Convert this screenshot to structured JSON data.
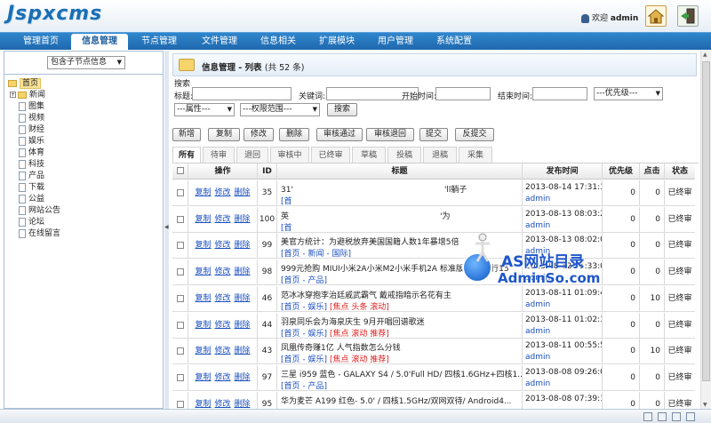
{
  "header": {
    "logo": "Jspxcms",
    "welcome_prefix": "欢迎",
    "username": "admin"
  },
  "nav": {
    "items": [
      "管理首页",
      "信息管理",
      "节点管理",
      "文件管理",
      "信息相关",
      "扩展模块",
      "用户管理",
      "系统配置"
    ],
    "active": "信息管理"
  },
  "sidebar": {
    "scope_select": "包含子节点信息",
    "tree": {
      "root": "首页",
      "children": [
        "新闻",
        "图集",
        "视频",
        "财经",
        "娱乐",
        "体育",
        "科技",
        "产品",
        "下载",
        "公益",
        "网站公告",
        "论坛",
        "在线留言"
      ]
    }
  },
  "page": {
    "title": "信息管理 - 列表",
    "count": "(共 52 条)"
  },
  "search": {
    "heading": "搜索",
    "title_label": "标题:",
    "keyword_label": "关键词:",
    "start_label": "开始时间:",
    "end_label": "结束时间:",
    "priority_select": "---优先级---",
    "attr_select": "---属性---",
    "scope_select": "---权限范围---",
    "search_button": "搜索"
  },
  "toolbar": [
    "新增",
    "复制",
    "修改",
    "删除",
    "审核通过",
    "审核退回",
    "提交",
    "反提交"
  ],
  "tabs": [
    "所有",
    "待审",
    "退回",
    "审核中",
    "已终审",
    "草稿",
    "投稿",
    "退稿",
    "采集"
  ],
  "table": {
    "columns": [
      "操作",
      "ID",
      "标题",
      "发布时间",
      "优先级",
      "点击",
      "状态"
    ],
    "op_labels": [
      "复制",
      "修改",
      "删除"
    ],
    "rows": [
      {
        "id": "35",
        "title": "31'",
        "title_tail": "'ll躺子",
        "crumb": "[首",
        "tags": "",
        "time": "2013-08-14 17:31:38",
        "user": "admin",
        "priority": "0",
        "clicks": "0",
        "status": "已终审"
      },
      {
        "id": "100",
        "title": "英",
        "title_tail": "'为",
        "crumb": "[首",
        "tags": "",
        "time": "2013-08-13 08:03:20",
        "user": "admin",
        "priority": "0",
        "clicks": "0",
        "status": "已终审"
      },
      {
        "id": "99",
        "title": "美官方统计：为避税放弃美国国籍人数1年暴增5倍",
        "title_tail": "",
        "crumb": "[首页 - 新闻 - 国际]",
        "tags": "",
        "time": "2013-08-13 08:02:06",
        "user": "admin",
        "priority": "0",
        "clicks": "0",
        "status": "已终审"
      },
      {
        "id": "98",
        "title": "999元抢购 MIUI小米2A小米M2小米手机2A 标准版16G 国行15",
        "title_tail": "",
        "crumb": "[首页 - 产品]",
        "tags": "",
        "time": "2013-08-12 01:33:02",
        "user": "admin",
        "priority": "0",
        "clicks": "0",
        "status": "已终审"
      },
      {
        "id": "46",
        "title": "范冰冰穿抱李治廷戚武霸气 戴戒指暗示名花有主",
        "title_tail": "",
        "crumb": "[首页 - 娱乐]",
        "tags": "[焦点 头条 滚动]",
        "time": "2013-08-11 01:09:43",
        "user": "admin",
        "priority": "0",
        "clicks": "10",
        "status": "已终审"
      },
      {
        "id": "44",
        "title": "羽泉同乐会为海泉庆生 9月开唱回谱歌迷",
        "title_tail": "",
        "crumb": "[首页 - 娱乐]",
        "tags": "[焦点 滚动 推荐]",
        "time": "2013-08-11 01:02:32",
        "user": "admin",
        "priority": "0",
        "clicks": "0",
        "status": "已终审"
      },
      {
        "id": "43",
        "title": "凤凰传奇赚1亿 人气指数怎么分钱",
        "title_tail": "",
        "crumb": "[首页 - 娱乐]",
        "tags": "[焦点 滚动 推荐]",
        "time": "2013-08-11 00:55:52",
        "user": "admin",
        "priority": "0",
        "clicks": "10",
        "status": "已终审"
      },
      {
        "id": "97",
        "title": "三星 i959 蓝色 - GALAXY S4 / 5.0'Full HD/ 四核1.6GHz+四核1...",
        "title_tail": "",
        "crumb": "[首页 - 产品]",
        "tags": "",
        "time": "2013-08-08 09:26:09",
        "user": "admin",
        "priority": "0",
        "clicks": "0",
        "status": "已终审"
      },
      {
        "id": "95",
        "title": "华为麦芒 A199 红色- 5.0' / 四核1.5GHz/双网双待/ Android4...",
        "title_tail": "",
        "crumb": "",
        "tags": "",
        "time": "2013-08-08 07:39:12",
        "user": "",
        "priority": "0",
        "clicks": "0",
        "status": "已终审"
      }
    ]
  },
  "watermark": {
    "line1": "AS网站目录",
    "line2": "AdminSo.com"
  }
}
